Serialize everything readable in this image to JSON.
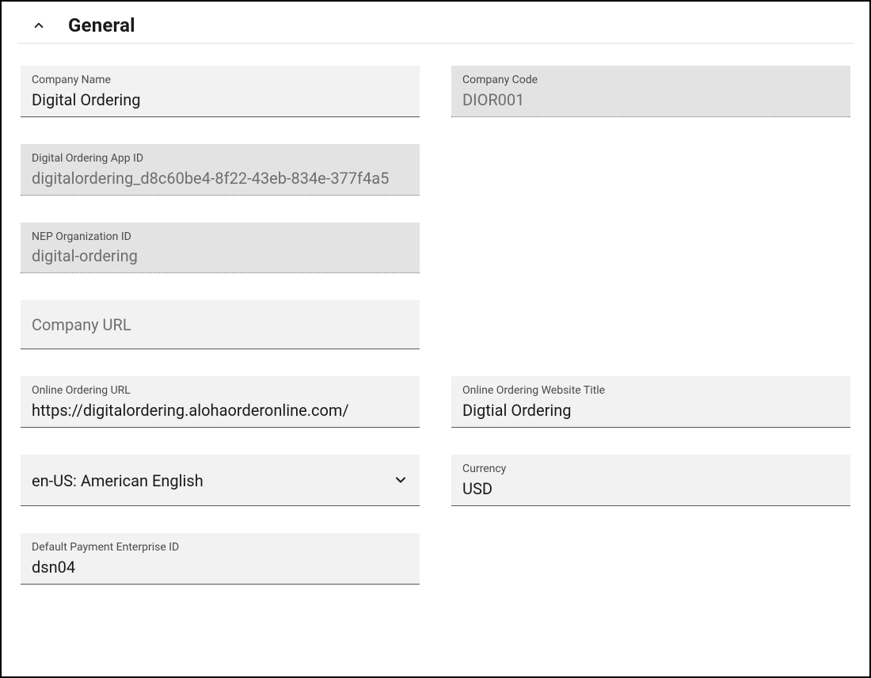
{
  "section": {
    "title": "General"
  },
  "fields": {
    "companyName": {
      "label": "Company Name",
      "value": "Digital Ordering"
    },
    "companyCode": {
      "label": "Company Code",
      "value": "DIOR001"
    },
    "appId": {
      "label": "Digital Ordering App ID",
      "value": "digitalordering_d8c60be4-8f22-43eb-834e-377f4a5"
    },
    "nepOrgId": {
      "label": "NEP Organization ID",
      "value": "digital-ordering"
    },
    "companyUrl": {
      "placeholder": "Company URL",
      "value": ""
    },
    "onlineOrderUrl": {
      "label": "Online Ordering URL",
      "value": "https://digitalordering.alohaorderonline.com/"
    },
    "websiteTitle": {
      "label": "Online Ordering Website Title",
      "value": "Digtial Ordering"
    },
    "locale": {
      "value": "en-US: American English"
    },
    "currency": {
      "label": "Currency",
      "value": "USD"
    },
    "paymentEnterprise": {
      "label": "Default Payment Enterprise ID",
      "value": "dsn04"
    }
  }
}
